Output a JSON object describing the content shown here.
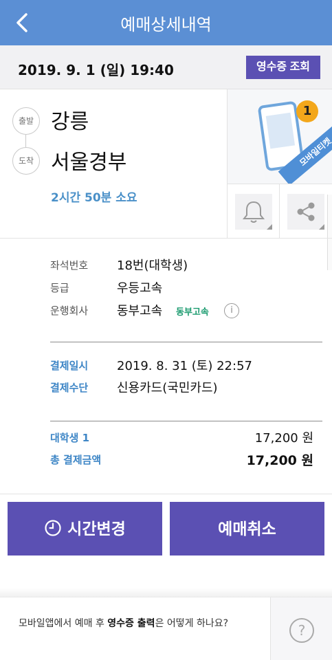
{
  "header": {
    "title": "예매상세내역",
    "back_icon": "chevron-left-icon"
  },
  "date_bar": {
    "datetime": "2019. 9. 1 (일) 19:40",
    "receipt_button": "영수증 조회"
  },
  "route": {
    "depart_label": "출발",
    "depart_city": "강릉",
    "arrive_label": "도착",
    "arrive_city": "서울경부",
    "duration": "2시간 50분 소요"
  },
  "mobile_ticket": {
    "badge_count": "1",
    "label": "모바일티켓"
  },
  "action_icons": [
    "bell-icon",
    "share-icon"
  ],
  "seat_info": {
    "seat_label": "좌석번호",
    "seat_value": "18번(대학생)",
    "grade_label": "등급",
    "grade_value": "우등고속",
    "operator_label": "운행회사",
    "operator_value": "동부고속",
    "operator_logo": "동부고속"
  },
  "payment": {
    "date_label": "결제일시",
    "date_value": "2019. 8. 31 (토) 22:57",
    "method_label": "결제수단",
    "method_value": "신용카드(국민카드)"
  },
  "price": {
    "item_label": "대학생 1",
    "item_value": "17,200 원",
    "total_label": "총 결제금액",
    "total_value": "17,200 원"
  },
  "buttons": {
    "change_time": "시간변경",
    "cancel": "예매취소"
  },
  "faq": {
    "text_before": "모바일앱에서 예매 후 ",
    "text_bold": "영수증 출력",
    "text_after": "은 어떻게 하나요?"
  },
  "colors": {
    "header": "#5b8fd4",
    "accent_purple": "#5b50b3",
    "link_blue": "#3e86c6",
    "badge_orange": "#f3a71b"
  }
}
